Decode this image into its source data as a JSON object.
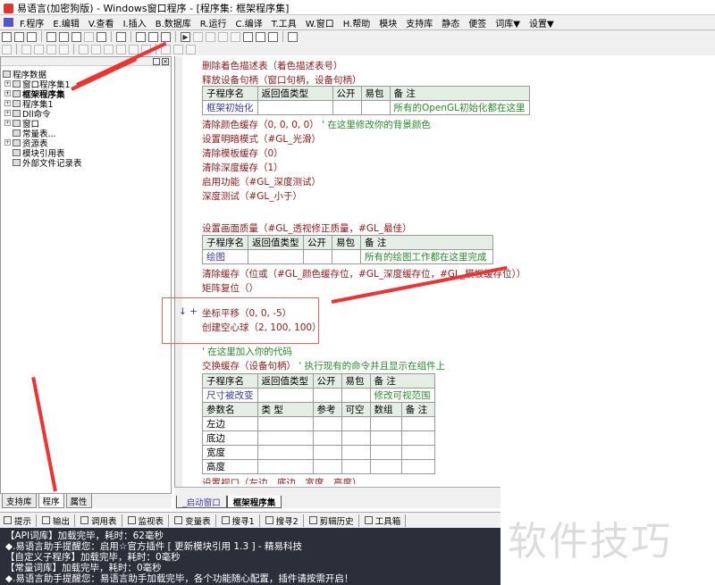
{
  "window": {
    "title": "易语言(加密狗版) - Windows窗口程序 - [程序集: 框架程序集]"
  },
  "menu": [
    "F.程序",
    "E.编辑",
    "V.查看",
    "I.插入",
    "B.数据库",
    "R.运行",
    "C.编译",
    "T.工具",
    "W.窗口",
    "H.帮助",
    "模块",
    "支持库",
    "静态",
    "便签",
    "词库▼",
    "设置▼"
  ],
  "tree": {
    "root": "程序数据",
    "items": [
      "窗口程序集1",
      "框架程序集",
      "程序集1",
      "Dll命令",
      "窗口",
      "常量表...",
      "资源表",
      "模块引用表",
      "外部文件记录表"
    ]
  },
  "left_tabs": [
    "支持库",
    "程序",
    "属性"
  ],
  "code": {
    "pre": [
      "删除着色描述表（着色描述表号）",
      "释放设备句柄（窗口句柄，设备句柄）"
    ],
    "table_headers": [
      "子程序名",
      "返回值类型",
      "公开",
      "易包",
      "备 注"
    ],
    "sub1": {
      "name": "框架初始化",
      "note": "所有的OpenGL初始化都在这里"
    },
    "block1": [
      {
        "code": "清除颜色缓存（0, 0, 0, 0）",
        "comment": "' 在这里修改你的背景颜色"
      },
      {
        "code": "设置明暗模式（#GL_光滑）"
      },
      {
        "code": "清除模板缓存（0）"
      },
      {
        "code": "清除深度缓存（1）"
      },
      {
        "code": "启用功能（#GL_深度测试）"
      },
      {
        "code": "深度测试（#GL_小于）"
      }
    ],
    "quality": "设置画面质量（#GL_透视修正质量，#GL_最佳）",
    "sub2": {
      "name": "绘图",
      "note": "所有的绘图工作都在这里完成"
    },
    "block2": [
      "清除缓存（位或（#GL_颜色缓存位，#GL_深度缓存位，#GL_模板缓存位））",
      "矩阵复位（）"
    ],
    "gutter_marks": "↓ +",
    "highlight": [
      "坐标平移（0, 0, -5）",
      "创建空心球（2, 100, 100）"
    ],
    "comment_add": "' 在这里加入你的代码",
    "swap": {
      "code": "交换缓存（设备句柄）",
      "comment": "' 执行现有的命令并且显示在组件上"
    },
    "sub3": {
      "name": "尺寸被改变",
      "note": "修改可视范围"
    },
    "param_headers": [
      "参数名",
      "类 型",
      "参考",
      "可空",
      "数组",
      "备 注"
    ],
    "params": [
      "左边",
      "底边",
      "宽度",
      "高度"
    ],
    "last": "设置视口（左边，底边，宽度，高度）"
  },
  "doc_tabs": [
    "_启动窗口",
    "框架程序集"
  ],
  "output_tabs": [
    "提示",
    "输出",
    "调用表",
    "监视表",
    "变量表",
    "搜寻1",
    "搜寻2",
    "剪辑历史",
    "工具箱"
  ],
  "output_lines": [
    "【API词库】加载完毕，耗时：62毫秒",
    "◆.易语言助手提醒您：启用☆官方插件 [ 更新模块引用 1.3 ] - 精易科技",
    "【自定义子程序】加载完毕，耗时：0毫秒",
    "【常量词库】加载完毕，耗时：0毫秒",
    "◆.易语言助手提醒您：易语言助手加载完毕，各个功能随心配置，插件请按需开启！",
    "- - - - - - - - - - - - - - - - - - - - - - - - - - - - - - - - - - - - - - - -"
  ],
  "watermark": "软件技巧"
}
